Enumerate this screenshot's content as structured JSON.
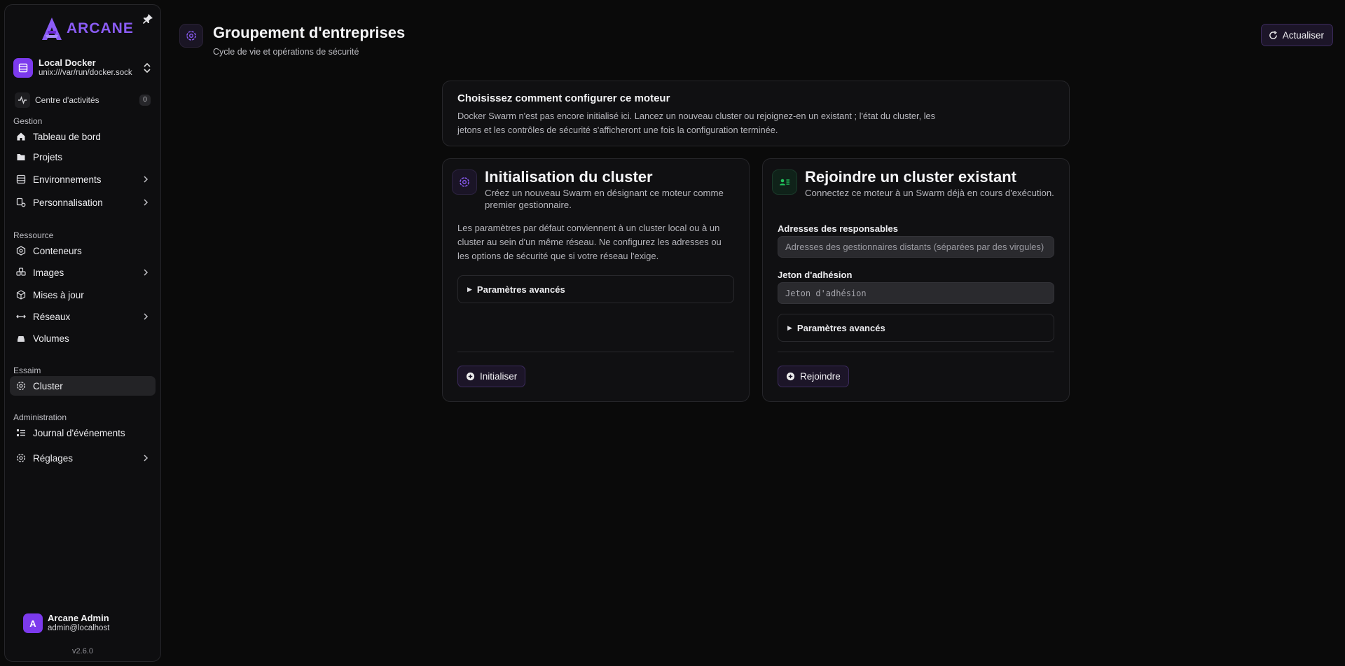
{
  "brand": {
    "name": "ARCANE",
    "accent": "#8b5cf6"
  },
  "environment": {
    "name": "Local Docker",
    "socket": "unix:///var/run/docker.sock"
  },
  "activity": {
    "label": "Centre d'activités",
    "count": "0"
  },
  "sidebar": {
    "sections": [
      {
        "label": "Gestion",
        "items": [
          {
            "label": "Tableau de bord",
            "icon": "home-icon"
          },
          {
            "label": "Projets",
            "icon": "folder-icon"
          },
          {
            "label": "Environnements",
            "icon": "server-icon",
            "expandable": true
          },
          {
            "label": "Personnalisation",
            "icon": "palette-icon",
            "expandable": true
          }
        ]
      },
      {
        "label": "Ressource",
        "items": [
          {
            "label": "Conteneurs",
            "icon": "container-icon"
          },
          {
            "label": "Images",
            "icon": "images-icon",
            "expandable": true
          },
          {
            "label": "Mises à jour",
            "icon": "package-icon"
          },
          {
            "label": "Réseaux",
            "icon": "network-icon",
            "expandable": true
          },
          {
            "label": "Volumes",
            "icon": "volume-icon"
          }
        ]
      },
      {
        "label": "Essaim",
        "items": [
          {
            "label": "Cluster",
            "icon": "cluster-icon",
            "active": true
          }
        ]
      },
      {
        "label": "Administration",
        "items": [
          {
            "label": "Journal d'événements",
            "icon": "log-icon"
          },
          {
            "label": "Réglages",
            "icon": "settings-icon",
            "expandable": true
          }
        ]
      }
    ]
  },
  "user": {
    "initial": "A",
    "name": "Arcane Admin",
    "email": "admin@localhost"
  },
  "version": "v2.6.0",
  "header": {
    "title": "Groupement d'entreprises",
    "subtitle": "Cycle de vie et opérations de sécurité",
    "refresh_label": "Actualiser"
  },
  "intro": {
    "title": "Choisissez comment configurer ce moteur",
    "text": "Docker Swarm n'est pas encore initialisé ici. Lancez un nouveau cluster ou rejoignez-en un existant ; l'état du cluster, les jetons et les contrôles de sécurité s'afficheront une fois la configuration terminée."
  },
  "init_card": {
    "title": "Initialisation du cluster",
    "description": "Créez un nouveau Swarm en désignant ce moteur comme premier gestionnaire.",
    "body": "Les paramètres par défaut conviennent à un cluster local ou à un cluster au sein d'un même réseau. Ne configurez les adresses ou les options de sécurité que si votre réseau l'exige.",
    "advanced_label": "Paramètres avancés",
    "button_label": "Initialiser"
  },
  "join_card": {
    "title": "Rejoindre un cluster existant",
    "description": "Connectez ce moteur à un Swarm déjà en cours d'exécution.",
    "managers_label": "Adresses des responsables",
    "managers_placeholder": "Adresses des gestionnaires distants (séparées par des virgules)",
    "token_label": "Jeton d'adhésion",
    "token_placeholder": "Jeton d'adhésion",
    "advanced_label": "Paramètres avancés",
    "button_label": "Rejoindre"
  }
}
